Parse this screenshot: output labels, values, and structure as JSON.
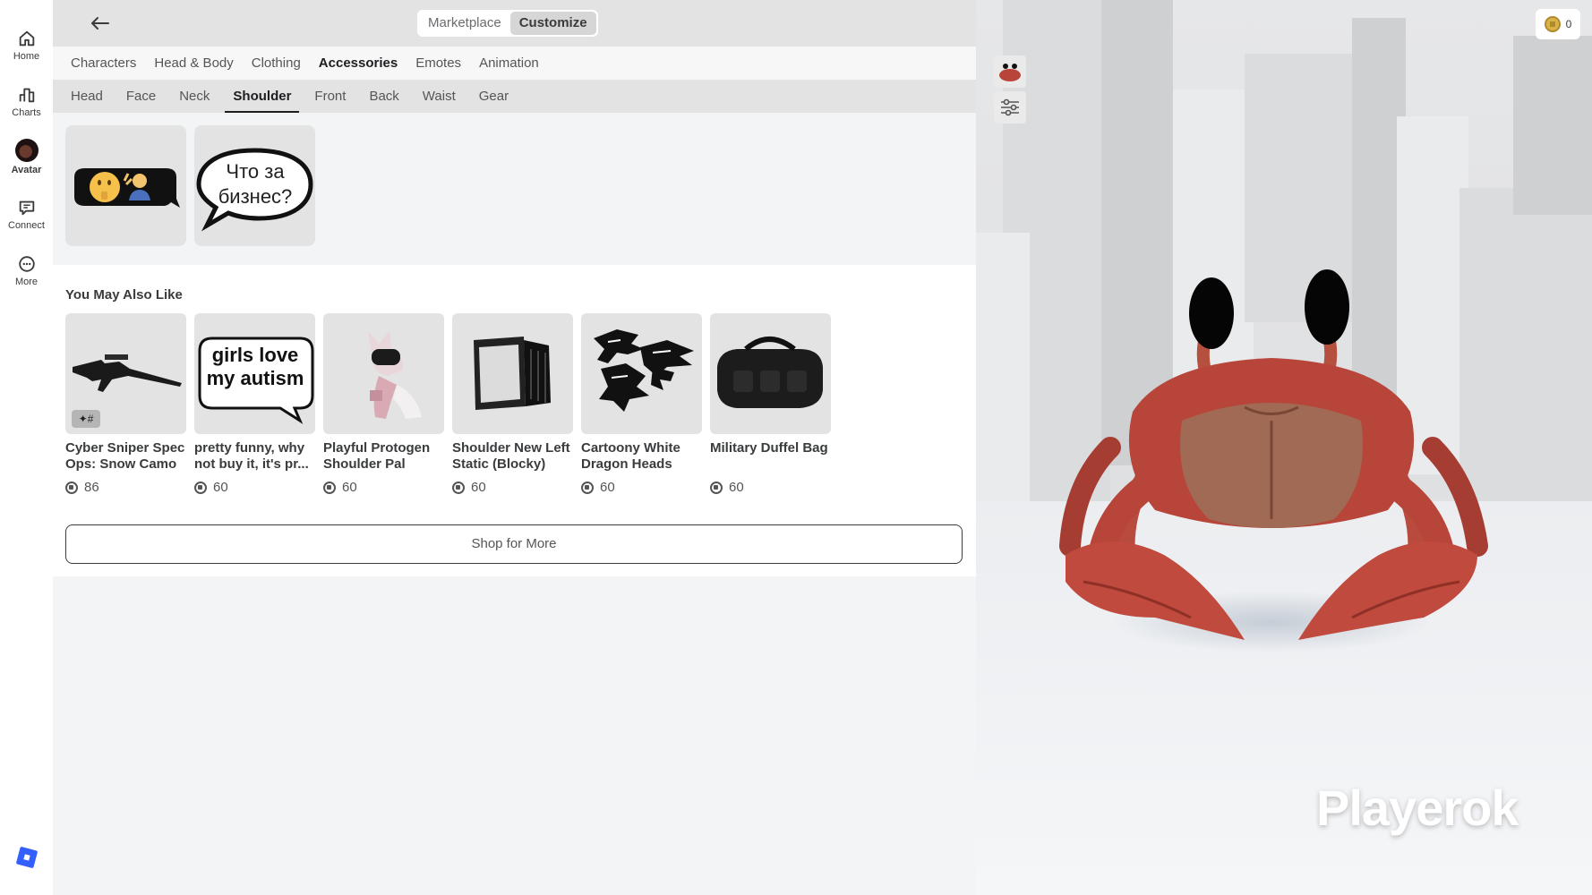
{
  "rail": {
    "items": [
      {
        "label": "Home",
        "icon": "home-icon"
      },
      {
        "label": "Charts",
        "icon": "charts-icon"
      },
      {
        "label": "Avatar",
        "icon": "avatar-icon"
      },
      {
        "label": "Connect",
        "icon": "chat-icon"
      },
      {
        "label": "More",
        "icon": "more-icon"
      }
    ]
  },
  "topbar": {
    "toggle": {
      "marketplace": "Marketplace",
      "customize": "Customize",
      "selected": "Customize"
    }
  },
  "categories": {
    "items": [
      "Characters",
      "Head & Body",
      "Clothing",
      "Accessories",
      "Emotes",
      "Animation"
    ],
    "active": "Accessories"
  },
  "subcategories": {
    "items": [
      "Head",
      "Face",
      "Neck",
      "Shoulder",
      "Front",
      "Back",
      "Waist",
      "Gear"
    ],
    "active": "Shoulder"
  },
  "equipped": {
    "tile2_text": "Что за бизнес?"
  },
  "recommendations": {
    "title": "You May Also Like",
    "items": [
      {
        "name": "Cyber Sniper Spec Ops: Snow Camo",
        "price": "86",
        "badge": "#"
      },
      {
        "name": "pretty funny, why not buy it, it's pr...",
        "price": "60",
        "thumb_text": "girls love my autism"
      },
      {
        "name": "Playful Protogen Shoulder Pal",
        "price": "60"
      },
      {
        "name": "Shoulder New Left Static (Blocky)",
        "price": "60"
      },
      {
        "name": "Cartoony White Dragon Heads",
        "price": "60"
      },
      {
        "name": "Military Duffel Bag",
        "price": "60"
      }
    ],
    "shop_label": "Shop for More"
  },
  "viewport": {
    "currency": "0",
    "watermark": "Playerok"
  },
  "colors": {
    "accent": "#335fff",
    "crab": "#b8453a"
  }
}
